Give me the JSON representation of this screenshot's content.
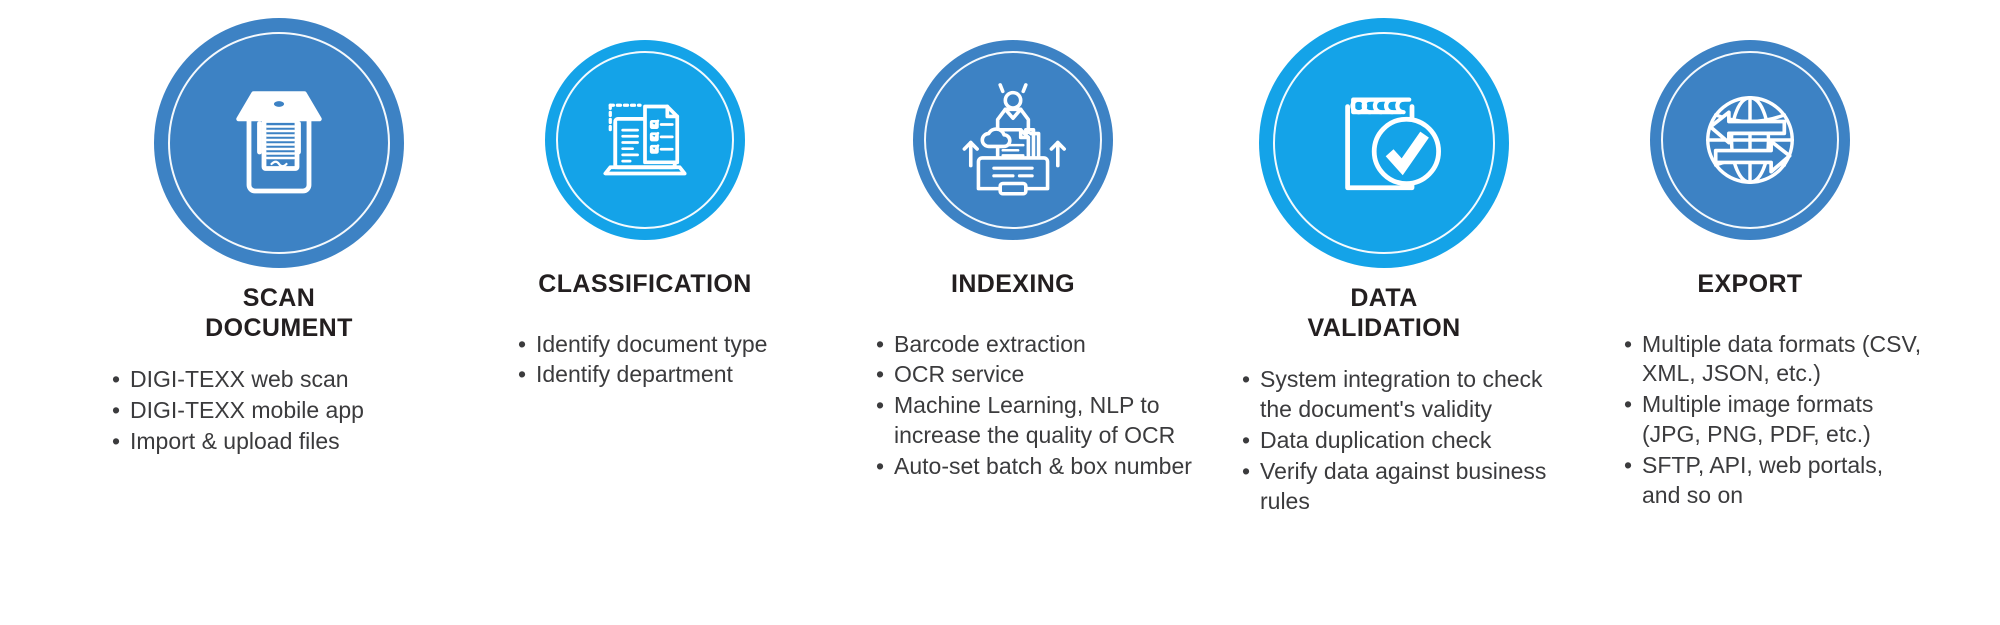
{
  "colors": {
    "dark_blue": "#3D82C4",
    "bright_blue": "#14A3E8",
    "icon_white": "#FFFFFF",
    "title_text": "#231f20",
    "body_text": "#3b3b3d",
    "background": "#FFFFFF"
  },
  "steps": [
    {
      "index": 1,
      "title": "SCAN\nDOCUMENT",
      "icon": "scanner-icon",
      "circle_color": "#3D82C4",
      "bullets": [
        "DIGI-TEXX web scan",
        "DIGI-TEXX mobile app",
        "Import & upload files"
      ]
    },
    {
      "index": 2,
      "title": "CLASSIFICATION",
      "icon": "laptop-checklist-icon",
      "circle_color": "#14A3E8",
      "bullets": [
        "Identify document type",
        "Identify department"
      ]
    },
    {
      "index": 3,
      "title": "INDEXING",
      "icon": "document-indexing-icon",
      "circle_color": "#3D82C4",
      "bullets": [
        "Barcode extraction",
        "OCR service",
        "Machine Learning, NLP to increase the quality of OCR",
        "Auto-set batch & box number"
      ]
    },
    {
      "index": 4,
      "title": "DATA\nVALIDATION",
      "icon": "notepad-checkmark-icon",
      "circle_color": "#14A3E8",
      "bullets": [
        "System integration to check the document's validity",
        "Data duplication check",
        "Verify data against business rules"
      ]
    },
    {
      "index": 5,
      "title": "EXPORT",
      "icon": "globe-arrows-icon",
      "circle_color": "#3D82C4",
      "bullets": [
        "Multiple data formats (CSV, XML, JSON, etc.)",
        "Multiple image formats (JPG, PNG, PDF, etc.)",
        "SFTP, API, web portals, and so on"
      ]
    }
  ]
}
